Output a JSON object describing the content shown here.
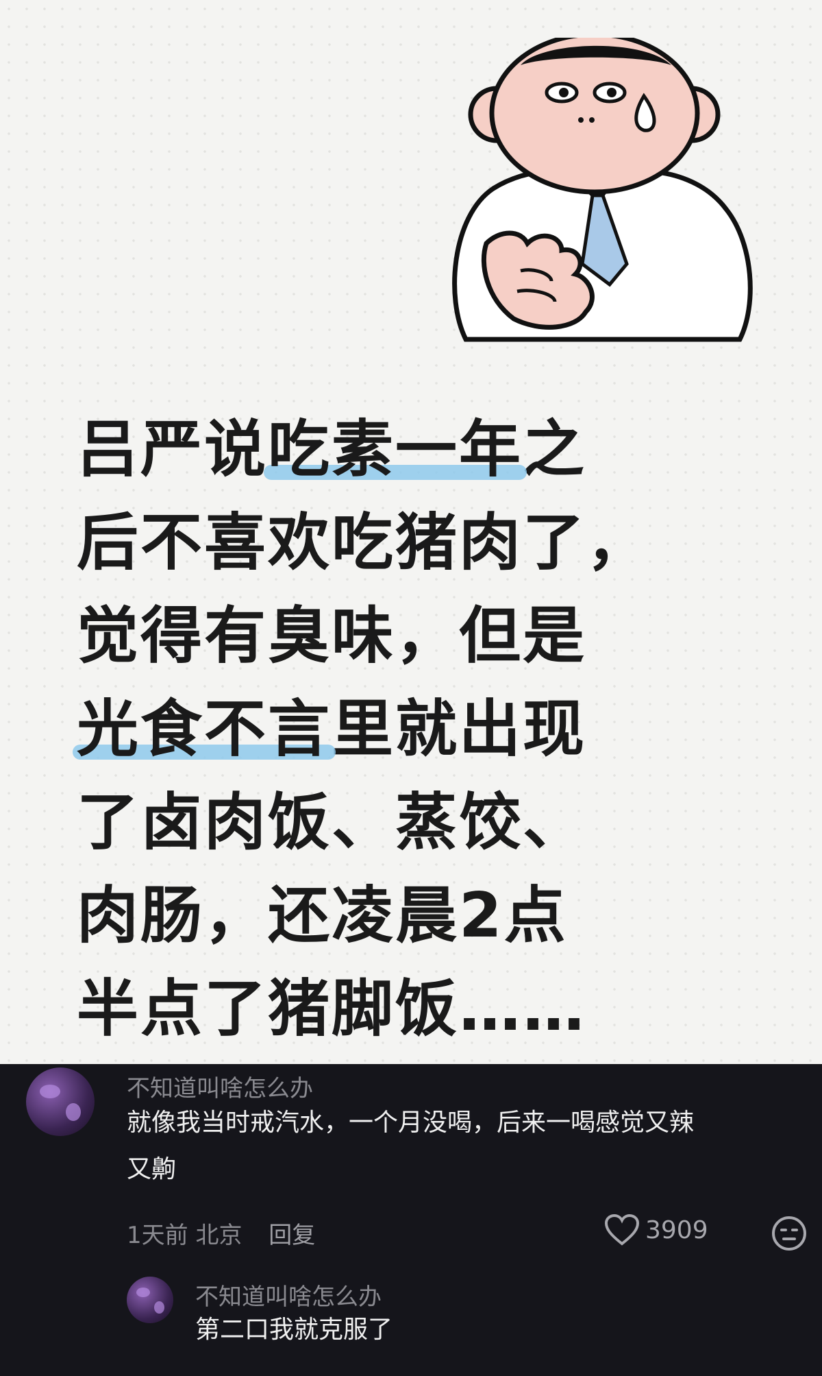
{
  "post": {
    "lines": [
      [
        "吕严说",
        "吃素一年",
        "之"
      ],
      [
        "后不喜欢吃猪肉了，",
        "",
        ""
      ],
      [
        "觉得有臭味，但是",
        "",
        ""
      ],
      [
        "",
        "光食不言",
        "里就出现"
      ],
      [
        "了卤肉饭、蒸饺、",
        "",
        ""
      ],
      [
        "肉肠，还凌晨2点",
        "",
        ""
      ],
      [
        "半点了猪脚饭……",
        "",
        ""
      ]
    ],
    "highlight_color": "#8ec9ec"
  },
  "comments": [
    {
      "username": "不知道叫啥怎么办",
      "text_line1": "就像我当时戒汽水，一个月没喝，后来一喝感觉又辣",
      "text_line2": "又齁",
      "time": "1天前",
      "location": "北京",
      "reply_label": "回复",
      "likes": "3909",
      "like_icon": "heart-icon",
      "emoji_icon": "meh-face-icon"
    },
    {
      "username": "不知道叫啥怎么办",
      "text": "第二口我就克服了"
    }
  ]
}
